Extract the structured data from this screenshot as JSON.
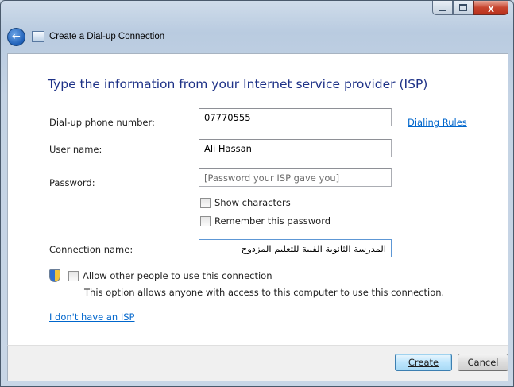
{
  "window": {
    "title": "Create a Dial-up Connection",
    "close_glyph": "x"
  },
  "header": {
    "back_glyph": "←"
  },
  "main": {
    "heading": "Type the information from your Internet service provider (ISP)",
    "phone": {
      "label": "Dial-up phone number:",
      "value": "07770555"
    },
    "dialing_rules_link": "Dialing Rules",
    "username": {
      "label": "User name:",
      "value": "Ali Hassan"
    },
    "password": {
      "label": "Password:",
      "placeholder": "[Password your ISP gave you]"
    },
    "show_characters": {
      "label": "Show characters",
      "checked": false
    },
    "remember_password": {
      "label": "Remember this password",
      "checked": false
    },
    "connection_name": {
      "label": "Connection name:",
      "value": "المدرسة الثانوية الفنية للتعليم المزدوج"
    },
    "allow_others": {
      "label": "Allow other people to use this connection",
      "checked": false
    },
    "allow_note": "This option allows anyone with access to this computer to use this connection.",
    "no_isp_link": "I don't have an ISP"
  },
  "footer": {
    "create_label": "Create",
    "cancel_label": "Cancel"
  }
}
